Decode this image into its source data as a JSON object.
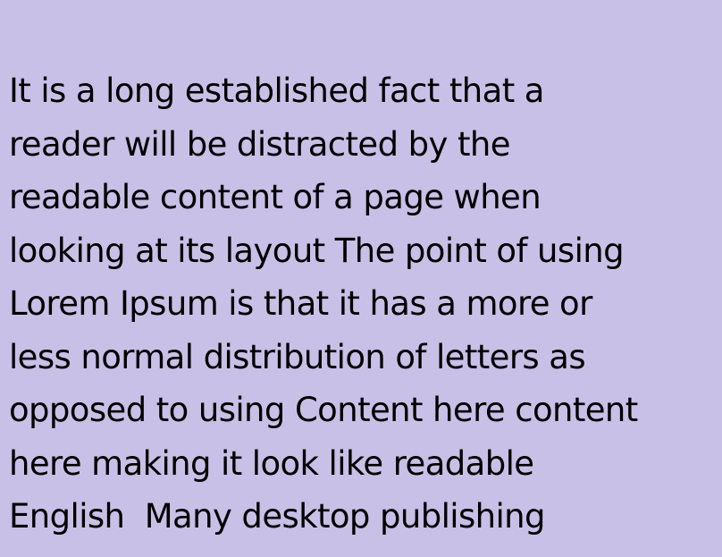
{
  "paragraph": {
    "lines": [
      "It is a long established fact that a",
      "reader will be distracted by the",
      "readable content of a page when",
      "looking at its layout The point of using",
      "Lorem Ipsum is that it has a more or",
      "less normal distribution of letters as",
      "opposed to using Content here content",
      "here making it look like readable",
      "English  Many desktop publishing"
    ]
  },
  "colors": {
    "background": "#c8c0e6",
    "text": "#000000"
  }
}
